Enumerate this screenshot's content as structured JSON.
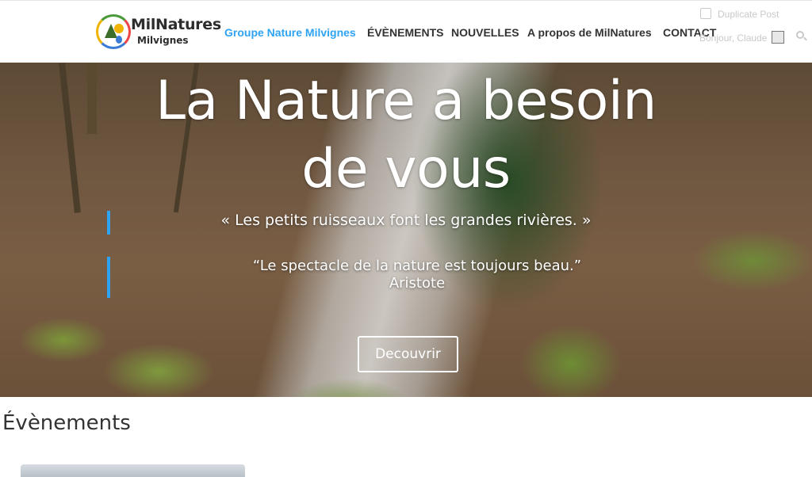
{
  "site": {
    "logo_title": "MilNatures",
    "logo_subtitle": "Milvignes"
  },
  "nav": {
    "items": [
      {
        "label": "Groupe Nature Milvignes",
        "active": true
      },
      {
        "label": "ÉVÈNEMENTS"
      },
      {
        "label": "NOUVELLES"
      },
      {
        "label": "A propos de MilNatures"
      },
      {
        "label": "CONTACT"
      }
    ]
  },
  "admin_bar": {
    "duplicate_post": "Duplicate Post",
    "greeting": "Bonjour, Claude"
  },
  "hero": {
    "title_line1": "La Nature a besoin",
    "title_line2": "de vous",
    "quote1": "« Les petits ruisseaux font les grandes rivières. »",
    "quote2": "“Le spectacle de la nature est toujours beau.”",
    "quote2_author": "Aristote",
    "cta_label": "Decouvrir"
  },
  "events": {
    "heading": "Évènements"
  },
  "colors": {
    "accent": "#2ea3f2",
    "nav_text": "#333333",
    "header_bg": "#ffffff"
  }
}
